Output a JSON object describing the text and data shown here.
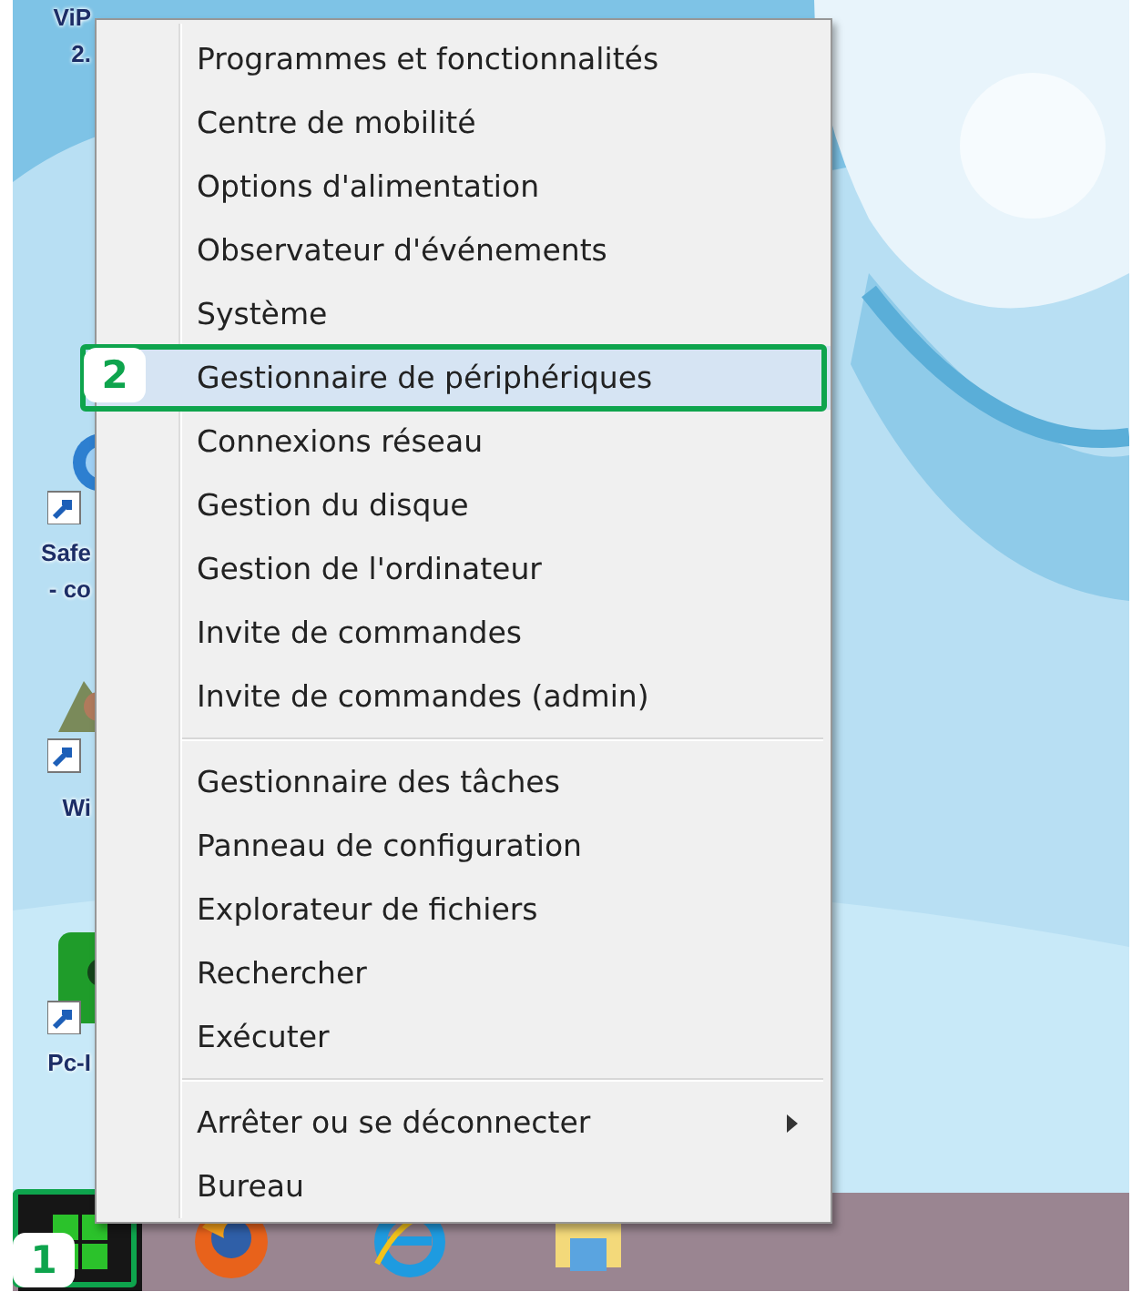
{
  "desktop": {
    "icons": [
      {
        "kind": "none",
        "lines": [
          "ViP",
          "2."
        ]
      },
      {
        "kind": "shortcut-blue",
        "lines": [
          "Safe",
          "- co"
        ]
      },
      {
        "kind": "shortcut-tree",
        "lines": [
          "Wi"
        ]
      },
      {
        "kind": "shortcut-green",
        "lines": [
          "Pc-I"
        ]
      }
    ]
  },
  "context_menu": {
    "sections": [
      [
        {
          "label": "Programmes et fonctionnalités",
          "selected": false
        },
        {
          "label": "Centre de mobilité",
          "selected": false
        },
        {
          "label": "Options d'alimentation",
          "selected": false
        },
        {
          "label": "Observateur d'événements",
          "selected": false
        },
        {
          "label": "Système",
          "selected": false
        },
        {
          "label": "Gestionnaire de périphériques",
          "selected": true,
          "callout": "2"
        },
        {
          "label": "Connexions réseau",
          "selected": false
        },
        {
          "label": "Gestion du disque",
          "selected": false
        },
        {
          "label": "Gestion de l'ordinateur",
          "selected": false
        },
        {
          "label": "Invite de commandes",
          "selected": false
        },
        {
          "label": "Invite de commandes (admin)",
          "selected": false
        }
      ],
      [
        {
          "label": "Gestionnaire des tâches",
          "selected": false
        },
        {
          "label": "Panneau de configuration",
          "selected": false
        },
        {
          "label": "Explorateur de fichiers",
          "selected": false
        },
        {
          "label": "Rechercher",
          "selected": false
        },
        {
          "label": "Exécuter",
          "selected": false
        }
      ],
      [
        {
          "label": "Arrêter ou se déconnecter",
          "selected": false,
          "submenu": true
        },
        {
          "label": "Bureau",
          "selected": false
        }
      ]
    ]
  },
  "taskbar": {
    "start_button": {
      "callout": "1"
    },
    "apps": [
      {
        "kind": "firefox"
      },
      {
        "kind": "ie"
      },
      {
        "kind": "explorer"
      }
    ]
  }
}
